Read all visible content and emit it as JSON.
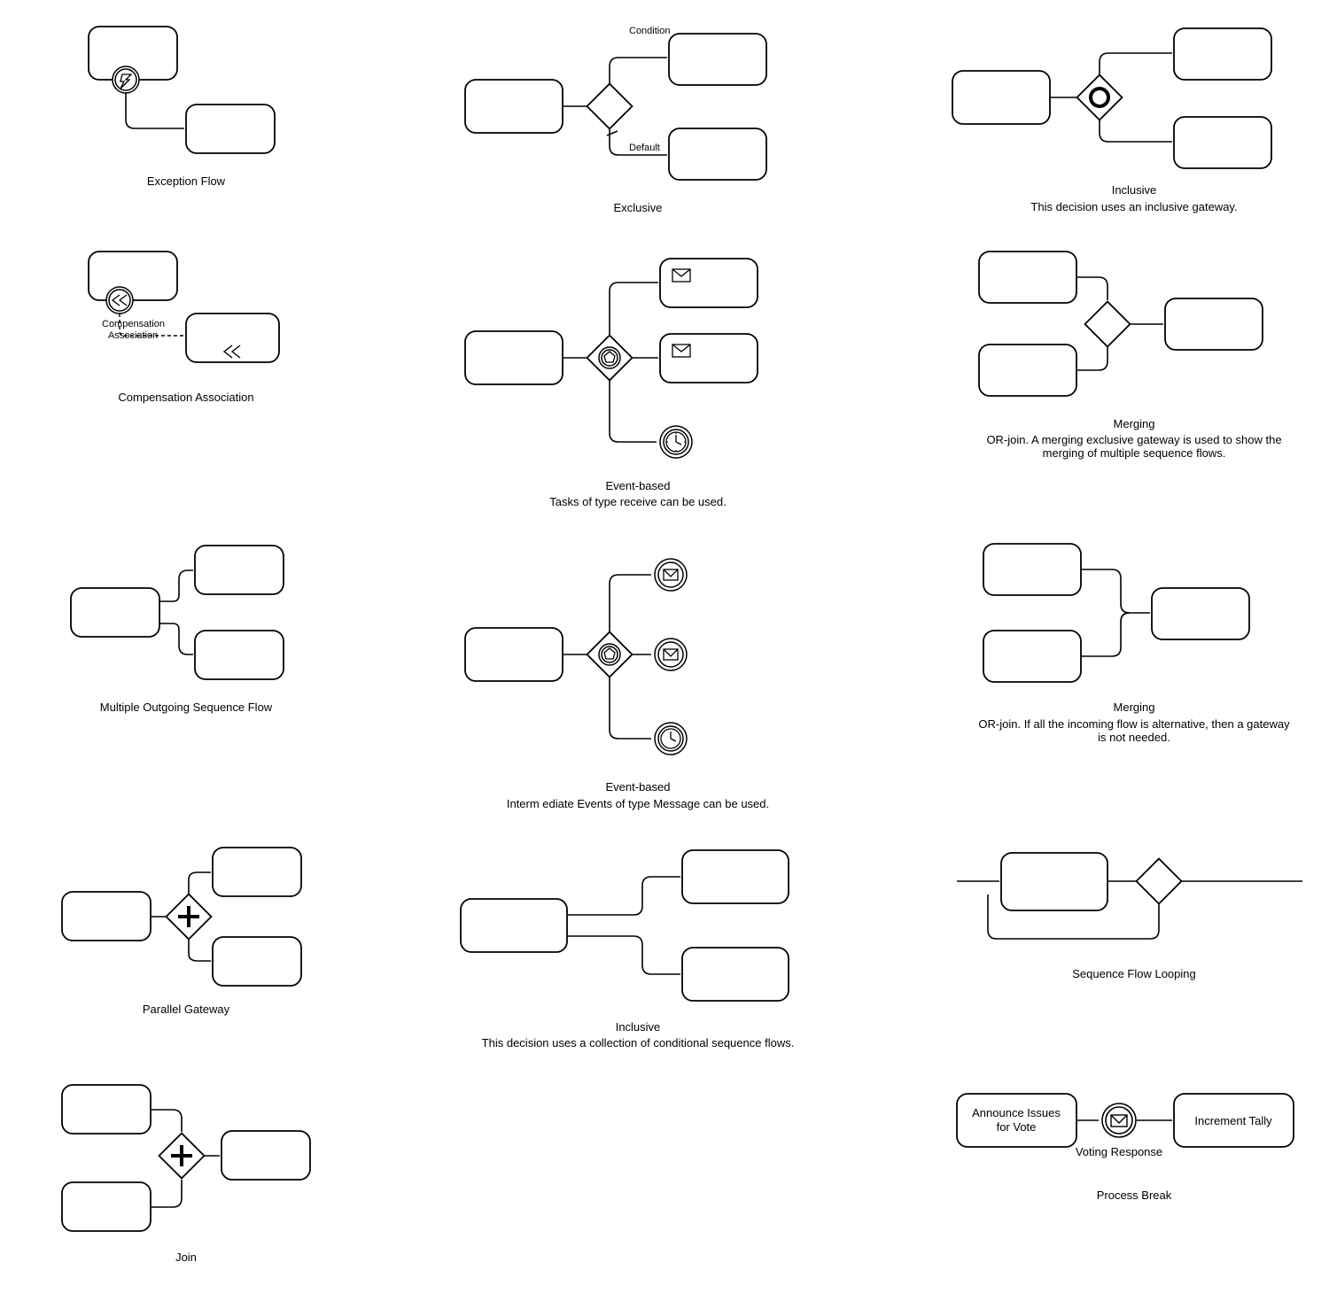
{
  "diagrams": {
    "exception_flow": {
      "title": "Exception Flow"
    },
    "compensation": {
      "title": "Compensation Association",
      "label": "Compensation\nAssociation"
    },
    "multiple_outgoing": {
      "title": "Multiple Outgoing Sequence Flow"
    },
    "parallel_gateway": {
      "title": "Parallel Gateway"
    },
    "join": {
      "title": "Join"
    },
    "exclusive": {
      "title": "Exclusive",
      "cond": "Condition",
      "def": "Default"
    },
    "event_based_tasks": {
      "title": "Event-based",
      "sub": "Tasks of type receive can be used."
    },
    "event_based_msg": {
      "title": "Event-based",
      "sub": "Interm ediate Events of type Message can be used."
    },
    "inclusive_conditional": {
      "title": "Inclusive",
      "sub": "This decision uses a collection of conditional sequence flows."
    },
    "inclusive_gateway": {
      "title": "Inclusive",
      "sub": "This decision uses an inclusive gateway."
    },
    "merging_or": {
      "title": "Merging",
      "sub": "OR-join. A merging exclusive gateway is used to show the merging of multiple sequence flows."
    },
    "merging_alt": {
      "title": "Merging",
      "sub": "OR-join. If all the incoming flow is alternative, then a gateway is not needed."
    },
    "seq_loop": {
      "title": "Sequence Flow Looping"
    },
    "process_break": {
      "title": "Process Break",
      "task1": "Announce Issues for Vote",
      "event": "Voting Response",
      "task2": "Increment Tally"
    }
  }
}
